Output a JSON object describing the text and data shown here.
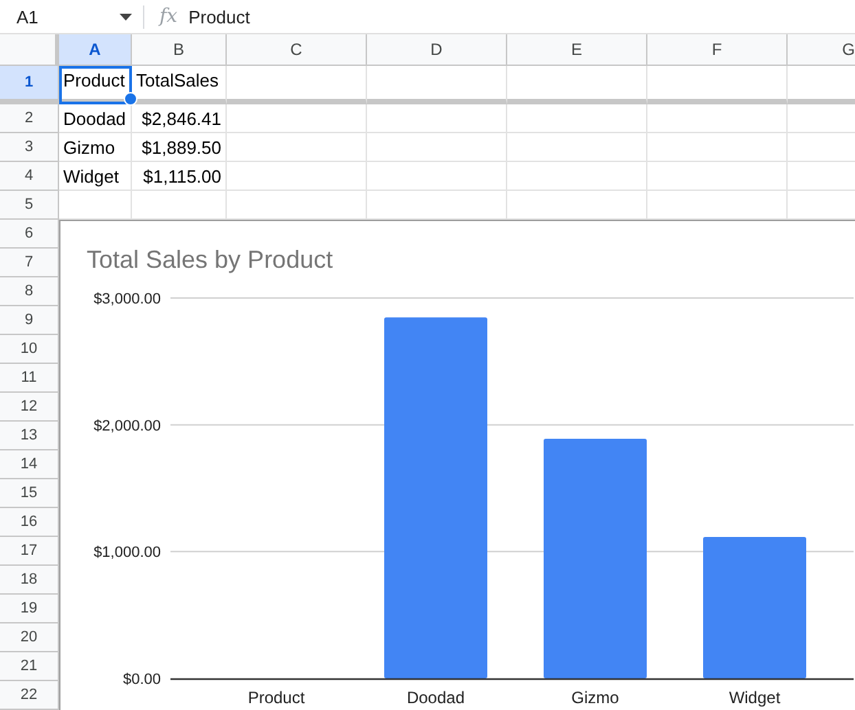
{
  "name_box": "A1",
  "formula_label": "fx",
  "formula": "Product",
  "columns": [
    {
      "label": "A",
      "selected": true
    },
    {
      "label": "B",
      "selected": false
    },
    {
      "label": "C",
      "selected": false
    },
    {
      "label": "D",
      "selected": false
    },
    {
      "label": "E",
      "selected": false
    },
    {
      "label": "F",
      "selected": false
    },
    {
      "label": "G",
      "selected": false
    }
  ],
  "rows": [
    {
      "label": "1",
      "selected": true,
      "frozen": true,
      "cells": [
        {
          "text": "Product",
          "kind": "text",
          "selected": true
        },
        {
          "text": "TotalSales",
          "kind": "text",
          "selected": false
        }
      ]
    },
    {
      "label": "2",
      "selected": false,
      "frozen": false,
      "cells": [
        {
          "text": "Doodad",
          "kind": "text",
          "selected": false
        },
        {
          "text": "$2,846.41",
          "kind": "number",
          "selected": false
        }
      ]
    },
    {
      "label": "3",
      "selected": false,
      "frozen": false,
      "cells": [
        {
          "text": "Gizmo",
          "kind": "text",
          "selected": false
        },
        {
          "text": "$1,889.50",
          "kind": "number",
          "selected": false
        }
      ]
    },
    {
      "label": "4",
      "selected": false,
      "frozen": false,
      "cells": [
        {
          "text": "Widget",
          "kind": "text",
          "selected": false
        },
        {
          "text": "$1,115.00",
          "kind": "number",
          "selected": false
        }
      ]
    },
    {
      "label": "5",
      "selected": false,
      "frozen": false,
      "cells": []
    }
  ],
  "chart_rows": [
    "6",
    "7",
    "8",
    "9",
    "10",
    "11",
    "12",
    "13",
    "14",
    "15",
    "16",
    "17",
    "18",
    "19",
    "20",
    "21",
    "22"
  ],
  "chart": {
    "chart_data": {
      "type": "bar",
      "title": "Total Sales by Product",
      "categories": [
        "Product",
        "Doodad",
        "Gizmo",
        "Widget"
      ],
      "series": [
        {
          "color": "#4285f4",
          "values": [
            null,
            2846.41,
            1889.5,
            1115
          ]
        }
      ],
      "ylim": [
        0,
        3000
      ],
      "yticks": [
        {
          "value": 0,
          "label": "$0.00"
        },
        {
          "value": 1000,
          "label": "$1,000.00"
        },
        {
          "value": 2000,
          "label": "$2,000.00"
        },
        {
          "value": 3000,
          "label": "$3,000.00"
        }
      ]
    }
  }
}
